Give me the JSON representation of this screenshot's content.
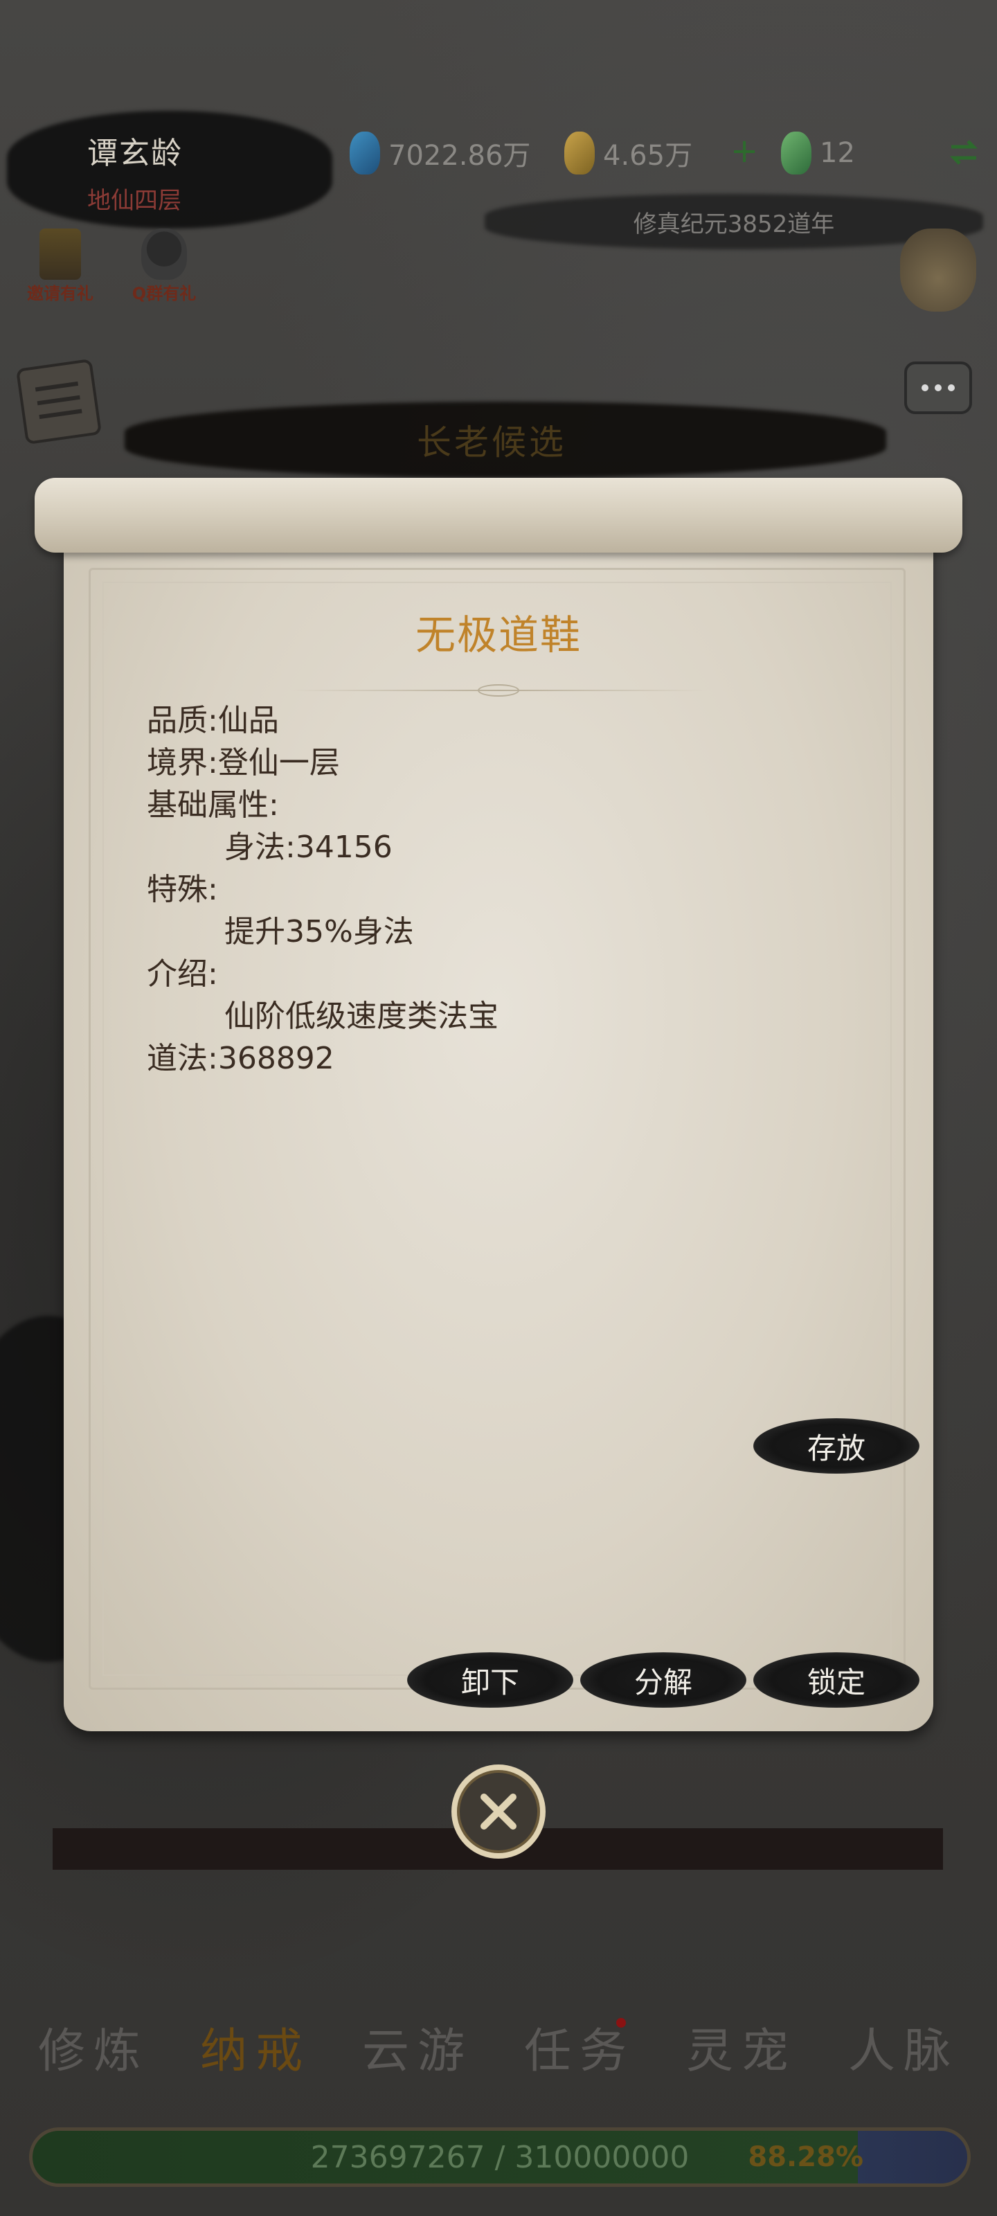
{
  "header": {
    "player_name": "谭玄龄",
    "player_rank": "地仙四层",
    "resources": [
      {
        "icon": "spirit-stone-icon",
        "value": "7022.86万"
      },
      {
        "icon": "gold-ingot-icon",
        "value": "4.65万"
      },
      {
        "icon": "jade-icon",
        "value": "12"
      }
    ],
    "add_symbol": "+",
    "era_text": "修真纪元3852道年"
  },
  "shortcuts": {
    "invite": "邀请有礼",
    "qq_group": "Q群有礼"
  },
  "page_title": "长老候选",
  "item_detail": {
    "name": "无极道鞋",
    "quality_label": "品质:",
    "quality_value": "仙品",
    "realm_label": "境界:",
    "realm_value": "登仙一层",
    "base_attr_label": "基础属性:",
    "base_attr_line": "身法:34156",
    "special_label": "特殊:",
    "special_line": "提升35%身法",
    "intro_label": "介绍:",
    "intro_line": "仙阶低级速度类法宝",
    "dao_label": "道法:",
    "dao_value": "368892"
  },
  "actions": {
    "store": "存放",
    "unequip": "卸下",
    "decompose": "分解",
    "lock": "锁定"
  },
  "bottom_nav": [
    {
      "label": "修炼",
      "active": false
    },
    {
      "label": "纳戒",
      "active": true
    },
    {
      "label": "云游",
      "active": false
    },
    {
      "label": "任务",
      "active": false,
      "badge": true
    },
    {
      "label": "灵宠",
      "active": false
    },
    {
      "label": "人脉",
      "active": false
    }
  ],
  "exp_bar": {
    "text": "273697267 / 310000000",
    "percent": "88.28%",
    "fraction": 0.8828
  },
  "colors": {
    "title_gold": "#c0832a",
    "rank_red": "#8c3b36",
    "paper": "#dad3c5"
  }
}
